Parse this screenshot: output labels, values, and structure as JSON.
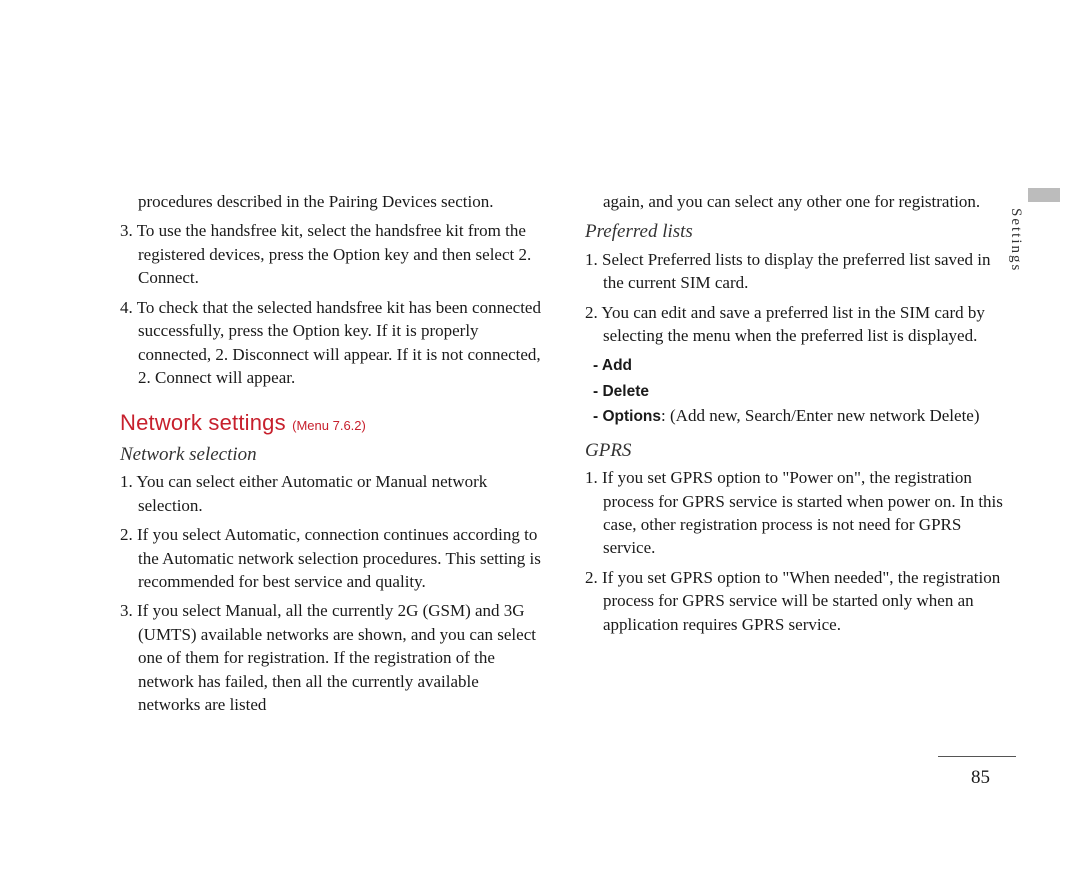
{
  "sideLabel": "Settings",
  "pageNumber": "85",
  "leftColumn": {
    "continuedList": [
      "procedures described in the Pairing Devices section.",
      "3. To use the handsfree kit, select the handsfree kit from the registered devices, press the Option key and then select 2. Connect.",
      "4. To check that the selected handsfree kit has been connected successfully, press the Option key. If it is properly connected, 2. Disconnect will appear. If it is not connected, 2. Connect will appear."
    ],
    "sectionTitle": "Network settings",
    "sectionMenuRef": "(Menu 7.6.2)",
    "sub1": {
      "heading": "Network selection",
      "items": [
        "1. You can select either Automatic or Manual network selection.",
        "2. If you select Automatic, connection continues according to the Automatic network selection procedures. This setting is recommended for best service and quality.",
        "3. If you select Manual, all the currently 2G (GSM) and 3G (UMTS) available networks are shown, and you can select one of them for registration. If the registration of the network has failed, then all the currently available networks are listed"
      ]
    }
  },
  "rightColumn": {
    "continuationText": "again, and you can select any other one for registration.",
    "sub2": {
      "heading": "Preferred lists",
      "items": [
        "1. Select Preferred lists to display the preferred list saved in the current SIM card.",
        "2. You can edit and save a preferred list in the SIM card by selecting the menu when the preferred list is displayed."
      ],
      "bullets": [
        "- Add",
        "- Delete"
      ],
      "optionsLabel": "- Options",
      "optionsText": ": (Add new, Search/Enter new network Delete)"
    },
    "sub3": {
      "heading": "GPRS",
      "items": [
        "1. If you set GPRS option to \"Power on\", the registration process for GPRS service is started when power on. In this case, other registration process is not need for GPRS service.",
        "2. If you set GPRS option to \"When needed\", the registration process for GPRS service will be started only when an application requires GPRS service."
      ]
    }
  }
}
